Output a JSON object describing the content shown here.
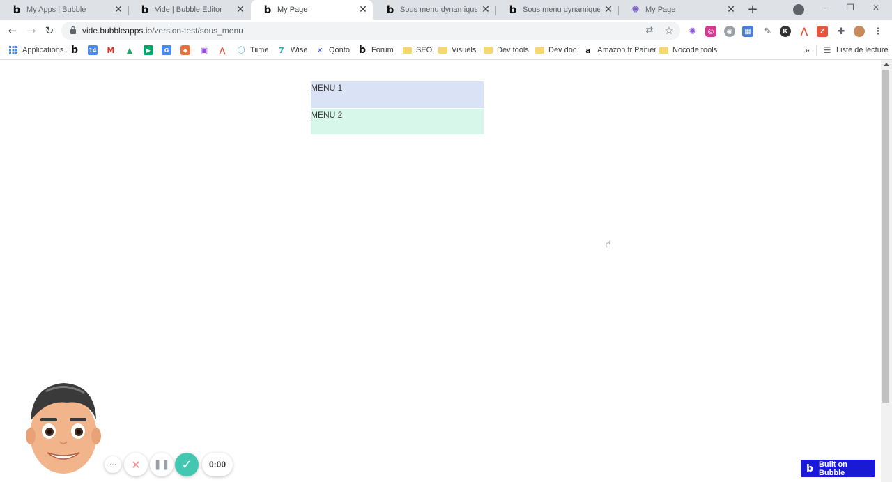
{
  "browser": {
    "tabs": [
      {
        "title": "My Apps | Bubble",
        "favicon": "bubble-icon",
        "active": false
      },
      {
        "title": "Vide | Bubble Editor",
        "favicon": "bubble-icon",
        "active": false
      },
      {
        "title": "My Page",
        "favicon": "bubble-icon",
        "active": true
      },
      {
        "title": "Sous menu dynamique - Of",
        "favicon": "bubble-icon",
        "active": false
      },
      {
        "title": "Sous menu dynamique - Of",
        "favicon": "bubble-icon",
        "active": false
      },
      {
        "title": "My Page",
        "favicon": "gear-flower-icon",
        "active": false
      }
    ],
    "url": {
      "host": "vide.bubbleapps.io",
      "path": "/version-test/sous_menu"
    },
    "bookmarks": [
      {
        "label": "Applications",
        "icon": "apps-grid-icon"
      },
      {
        "label": "",
        "icon": "bubble-icon"
      },
      {
        "label": "",
        "icon": "calendar-icon"
      },
      {
        "label": "",
        "icon": "gmail-icon"
      },
      {
        "label": "",
        "icon": "drive-icon"
      },
      {
        "label": "",
        "icon": "meet-icon"
      },
      {
        "label": "",
        "icon": "translate-icon"
      },
      {
        "label": "",
        "icon": "bookmark-orange-icon"
      },
      {
        "label": "",
        "icon": "twitch-icon"
      },
      {
        "label": "",
        "icon": "arrow-app-icon"
      },
      {
        "label": "Tiime",
        "icon": "tiime-icon"
      },
      {
        "label": "Wise",
        "icon": "wise-icon"
      },
      {
        "label": "Qonto",
        "icon": "qonto-icon"
      },
      {
        "label": "Forum",
        "icon": "bubble-icon"
      },
      {
        "label": "SEO",
        "icon": "folder-icon"
      },
      {
        "label": "Visuels",
        "icon": "folder-icon"
      },
      {
        "label": "Dev tools",
        "icon": "folder-icon"
      },
      {
        "label": "Dev doc",
        "icon": "folder-icon"
      },
      {
        "label": "Amazon.fr Panier",
        "icon": "amazon-icon"
      },
      {
        "label": "Nocode tools",
        "icon": "folder-icon"
      }
    ],
    "reading_list": "Liste de lecture",
    "overflow": "»"
  },
  "page": {
    "menu1": "MENU 1",
    "menu2": "MENU 2"
  },
  "recorder": {
    "timer": "0:00",
    "more": "···"
  },
  "badge": {
    "label": "Built on Bubble"
  },
  "colors": {
    "menu1_bg": "#dae3f5",
    "menu2_bg": "#d6f7ea",
    "badge_bg": "#1a1ad6",
    "done_button": "#44c7b1"
  }
}
